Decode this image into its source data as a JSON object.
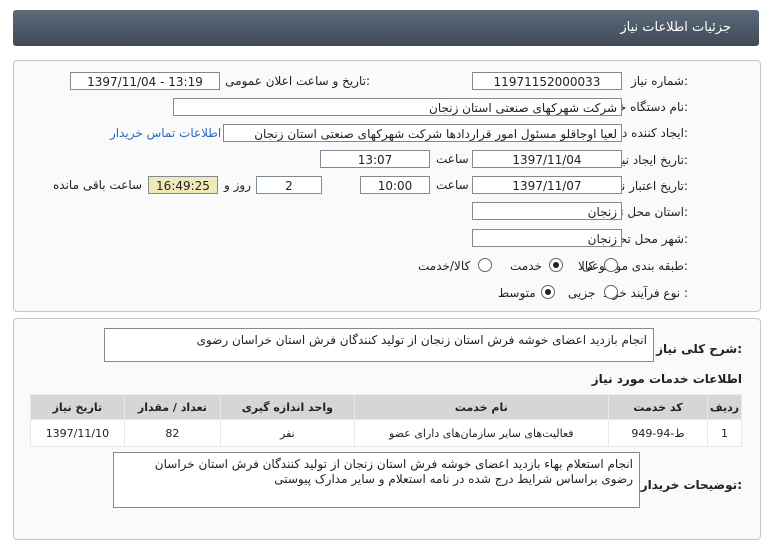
{
  "header": {
    "title": "جزئیات اطلاعات نیاز"
  },
  "form": {
    "need_no_label": "شماره نیاز:",
    "need_no": "11971152000033",
    "announce_label": "تاریخ و ساعت اعلان عمومی:",
    "announce_value": "1397/11/04 - 13:19",
    "buyer_label": "نام دستگاه خریدار:",
    "buyer_value": "شرکت شهرکهای صنعتی استان زنجان",
    "creator_label": "ایجاد کننده درخواست:",
    "creator_value": "لعیا اوجاقلو مسئول امور قراردادها شرکت شهرکهای صنعتی استان زنجان",
    "contact_link": "اطلاعات تماس خریدار",
    "create_date_label": "تاریخ ایجاد نیاز:",
    "create_date": "1397/11/04",
    "time_label": "ساعت",
    "create_time": "13:07",
    "valid_label": "تاریخ اعتبار نیاز:",
    "valid_date": "1397/11/07",
    "valid_time": "10:00",
    "days": "2",
    "days_label": "روز و",
    "remaining": "16:49:25",
    "remaining_label": "ساعت باقی مانده",
    "province_label": "استان محل تحویل:",
    "province": "زنجان",
    "city_label": "شهر محل تحویل:",
    "city": "زنجان",
    "category_label": "طبقه بندی موضوعی:",
    "category_options": [
      "کالا",
      "خدمت",
      "کالا/خدمت"
    ],
    "category_selected": "خدمت",
    "process_label": "نوع فرآیند خرید :",
    "process_options": [
      "جزیی",
      "متوسط"
    ],
    "process_selected": "متوسط"
  },
  "summary": {
    "label": "شرح کلی نیاز:",
    "text": "انجام بازدید اعضای خوشه فرش استان زنجان از تولید کنندگان فرش استان خراسان رضوی"
  },
  "services": {
    "title": "اطلاعات خدمات مورد نیاز",
    "columns": [
      "ردیف",
      "کد خدمت",
      "نام خدمت",
      "واحد اندازه گیری",
      "تعداد / مقدار",
      "تاریخ نیاز"
    ],
    "rows": [
      [
        "1",
        "ط-94-949",
        "فعالیت‌های سایر سازمان‌های دارای عضو",
        "نفر",
        "82",
        "1397/11/10"
      ]
    ]
  },
  "buyer_notes": {
    "label": "توضیحات خریدار:",
    "text": "انجام استعلام بهاء بازدید اعضای خوشه فرش استان زنجان از تولید کنندگان فرش استان خراسان رضوی براساس شرایط درج شده در نامه استعلام و سایر مدارک پیوستی"
  }
}
